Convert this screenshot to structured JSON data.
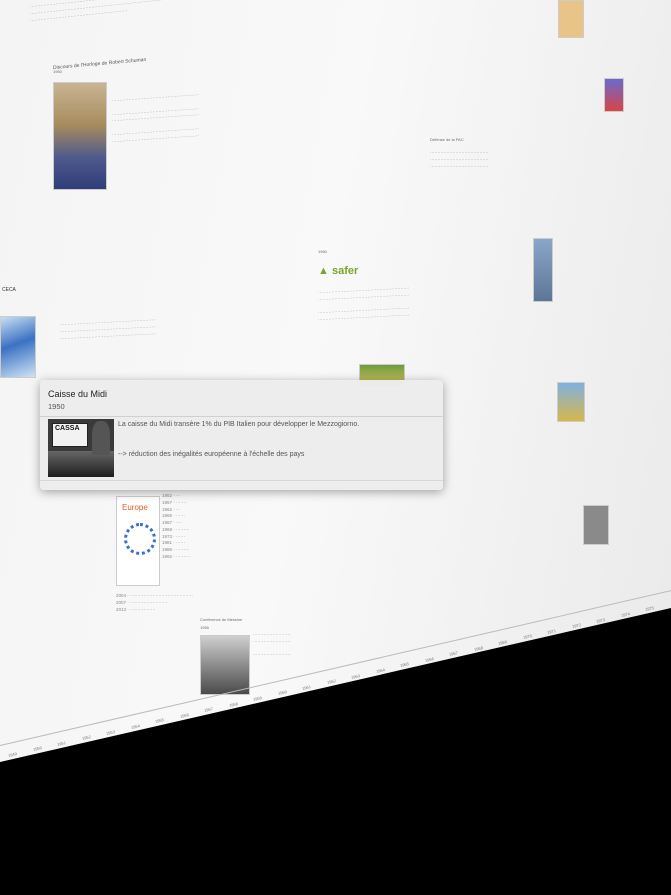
{
  "popup": {
    "title": "Caisse du Midi",
    "year": "1950",
    "text_1": "La caisse du Midi transère 1% du PIB Italien pour développer le Mezzogiorno.",
    "text_2": "--> réduction des inégalités européenne à l'échelle des pays",
    "image_caption": "CASSA"
  },
  "background": {
    "schuman_title": "Discours de l'Horloge de Robert Schuman",
    "schuman_year": "1950",
    "ceca_label": "CECA",
    "defense_title": "Défense de la PAC",
    "safer_logo": "safer",
    "safer_year": "1960",
    "europe_logo": "Europe",
    "messina_title": "Conférence de Messine",
    "messina_year": "1955",
    "timeline_years": [
      "1949",
      "1950",
      "1951",
      "1952",
      "1953",
      "1954",
      "1955",
      "1956",
      "1957",
      "1958",
      "1959",
      "1960",
      "1961",
      "1962",
      "1963",
      "1964",
      "1965",
      "1966",
      "1967",
      "1968",
      "1969",
      "1970",
      "1971",
      "1972",
      "1973",
      "1974",
      "1975"
    ]
  }
}
